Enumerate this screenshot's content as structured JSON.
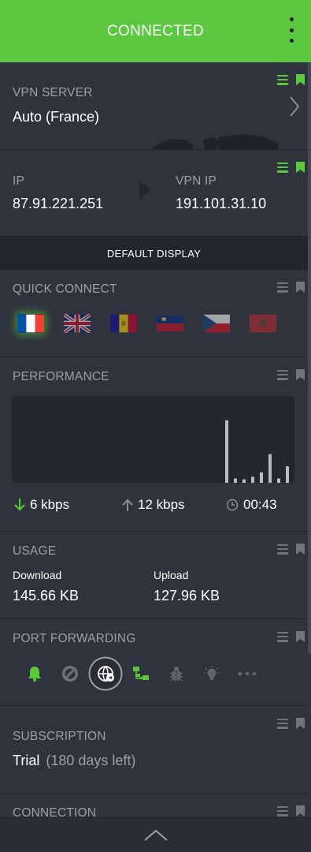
{
  "header": {
    "title": "CONNECTED"
  },
  "vpn_server": {
    "label": "VPN SERVER",
    "value": "Auto (France)"
  },
  "ip": {
    "ip_label": "IP",
    "ip_value": "87.91.221.251",
    "vpn_ip_label": "VPN IP",
    "vpn_ip_value": "191.101.31.10"
  },
  "default_display": {
    "label": "DEFAULT DISPLAY"
  },
  "quick_connect": {
    "label": "QUICK CONNECT",
    "flags": [
      "France",
      "United Kingdom",
      "Andorra",
      "Liechtenstein",
      "Czech Republic",
      "Morocco"
    ]
  },
  "performance": {
    "label": "PERFORMANCE",
    "download": "6 kbps",
    "upload": "12 kbps",
    "time": "00:43",
    "bars": [
      0.72,
      0.05,
      0.04,
      0.07,
      0.12,
      0.33,
      0.05,
      0.19,
      0.05
    ]
  },
  "usage": {
    "label": "USAGE",
    "download_label": "Download",
    "download_value": "145.66 KB",
    "upload_label": "Upload",
    "upload_value": "127.96 KB"
  },
  "port_forwarding": {
    "label": "PORT FORWARDING"
  },
  "subscription": {
    "label": "SUBSCRIPTION",
    "plan": "Trial",
    "days_left": "(180 days left)"
  },
  "connection": {
    "label": "CONNECTION"
  },
  "colors": {
    "accent": "#5bc83f",
    "background": "#2f333e",
    "dark": "#23262e"
  }
}
